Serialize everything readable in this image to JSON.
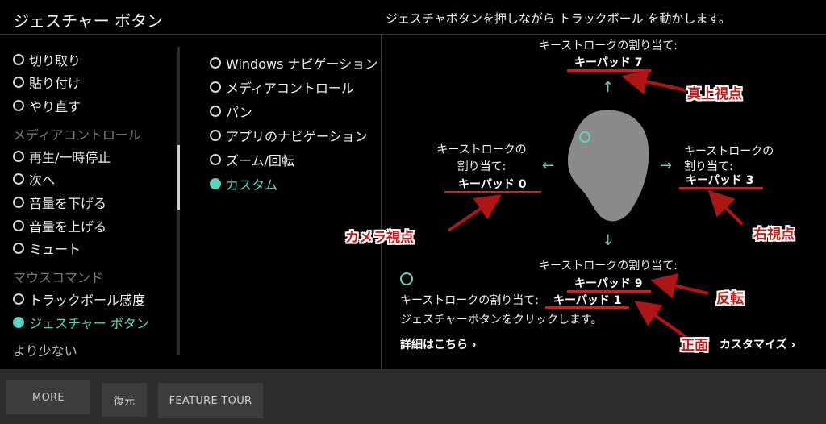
{
  "header": {
    "title": "ジェスチャー ボタン",
    "hint": "ジェスチャボタンを押しながら トラックボール を動かします。"
  },
  "left_list": [
    {
      "label": "切り取り",
      "type": "radio",
      "selected": false
    },
    {
      "label": "貼り付け",
      "type": "radio",
      "selected": false
    },
    {
      "label": "やり直す",
      "type": "radio",
      "selected": false
    },
    {
      "label": "メディアコントロール",
      "type": "heading"
    },
    {
      "label": "再生/一時停止",
      "type": "radio",
      "selected": false
    },
    {
      "label": "次へ",
      "type": "radio",
      "selected": false
    },
    {
      "label": "音量を下げる",
      "type": "radio",
      "selected": false
    },
    {
      "label": "音量を上げる",
      "type": "radio",
      "selected": false
    },
    {
      "label": "ミュート",
      "type": "radio",
      "selected": false
    },
    {
      "label": "マウスコマンド",
      "type": "heading"
    },
    {
      "label": "トラックボール感度",
      "type": "radio",
      "selected": false
    },
    {
      "label": "ジェスチャー ボタン",
      "type": "radio",
      "selected": true
    },
    {
      "label": "より少ない",
      "type": "link"
    }
  ],
  "mid_list": [
    {
      "label": "Windows ナビゲーション",
      "selected": false
    },
    {
      "label": "メディアコントロール",
      "selected": false
    },
    {
      "label": "パン",
      "selected": false
    },
    {
      "label": "アプリのナビゲーション",
      "selected": false
    },
    {
      "label": "ズーム/回転",
      "selected": false
    },
    {
      "label": "カスタム",
      "selected": true
    }
  ],
  "diagram": {
    "top": {
      "label": "キーストロークの割り当て:",
      "value": "キーパッド 7"
    },
    "left": {
      "label1": "キーストロークの",
      "label2": "割り当て:",
      "value": "キーパッド 0"
    },
    "right": {
      "label1": "キーストロークの",
      "label2": "割り当て:",
      "value": "キーパッド 3"
    },
    "bottom": {
      "label": "キーストロークの割り当て:",
      "value": "キーパッド 9"
    },
    "click": {
      "label": "キーストロークの割り当て:",
      "value": "キーパッド 1",
      "desc": "ジェスチャーボタンをクリックします。"
    }
  },
  "callouts": {
    "top_view": "真上視点",
    "camera_view": "カメラ視点",
    "right_view": "右視点",
    "flip": "反転",
    "front": "正面"
  },
  "links": {
    "details": "詳細はこちら",
    "customize": "カスタマイズ"
  },
  "footer": {
    "more": "MORE",
    "restore": "復元",
    "tour": "FEATURE TOUR"
  },
  "colors": {
    "accent": "#5ad3c0",
    "annotation": "#c41c1c",
    "footer_bg": "#2d2d2d"
  }
}
